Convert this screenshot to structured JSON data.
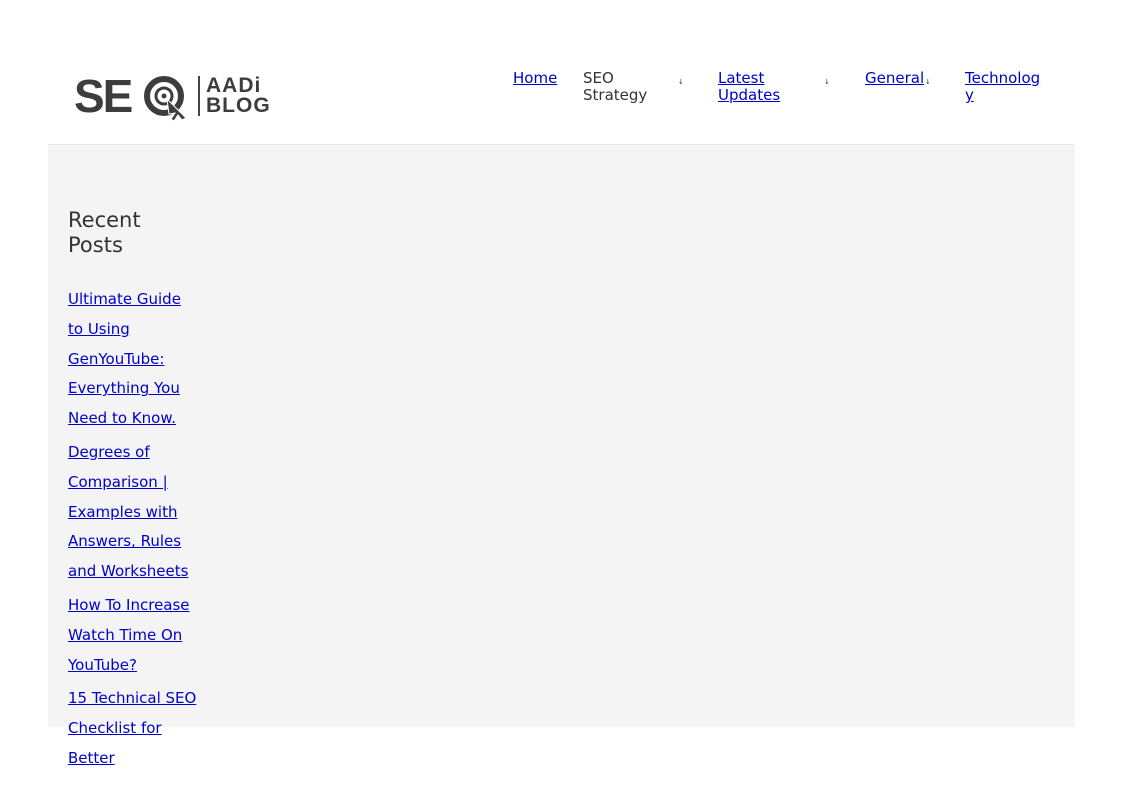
{
  "logo": {
    "mark": "SEO",
    "blog_top": "AADi",
    "blog_bottom": "BLOG"
  },
  "nav": {
    "items": [
      {
        "label": "Home",
        "has_dropdown": false
      },
      {
        "label": "SEO Strategy",
        "has_dropdown": true
      },
      {
        "label": "Latest Updates",
        "has_dropdown": true
      },
      {
        "label": "General",
        "has_dropdown": true
      },
      {
        "label": "Technology",
        "has_dropdown": false
      }
    ],
    "caret_glyph": "↓"
  },
  "sidebar": {
    "title": "Recent Posts",
    "posts": [
      {
        "title": "Ultimate Guide to Using GenYouTube: Everything You Need to Know."
      },
      {
        "title": "Degrees of Comparison | Examples with Answers, Rules and Worksheets"
      },
      {
        "title": "How To Increase Watch Time On YouTube?"
      },
      {
        "title": "15 Technical SEO Checklist for Better"
      }
    ]
  },
  "colors": {
    "link": "#0000cc",
    "link_alt": "#1a7fb3",
    "content_bg": "#f4f4f4",
    "logo_dark": "#3d3d3d"
  }
}
